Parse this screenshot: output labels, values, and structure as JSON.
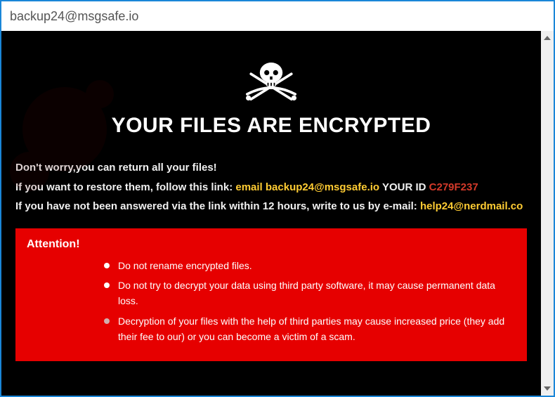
{
  "window": {
    "title": "backup24@msgsafe.io"
  },
  "ransom": {
    "headline": "YOUR FILES ARE ENCRYPTED",
    "line1": "Don't worry,you can return all your files!",
    "line2_pre": "If you want to restore them, follow this link: ",
    "line2_email_label": "email backup24@msgsafe.io",
    "line2_id_label": "  YOUR ID ",
    "line2_id_value": "C279F237",
    "line3_pre": "If you have not been answered via the link within 12 hours, write to us by e-mail: ",
    "line3_email": "help24@nerdmail.co"
  },
  "attention": {
    "title": "Attention!",
    "bullets": [
      "Do not rename encrypted files.",
      "Do not try to decrypt your data using third party software, it may cause permanent data loss.",
      "Decryption of your files with the help of third parties may cause increased price (they add their fee to our) or you can become a victim of a scam."
    ]
  }
}
